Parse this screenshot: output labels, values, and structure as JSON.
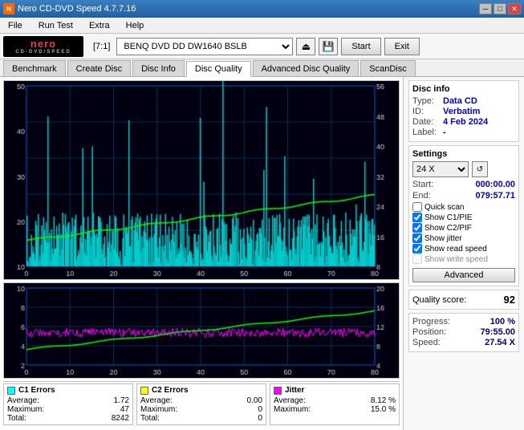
{
  "titleBar": {
    "title": "Nero CD-DVD Speed 4.7.7.16",
    "minBtn": "─",
    "maxBtn": "□",
    "closeBtn": "✕"
  },
  "menuBar": {
    "items": [
      "File",
      "Run Test",
      "Extra",
      "Help"
    ]
  },
  "toolbar": {
    "driveLabel": "[7:1]",
    "driveValue": "BENQ DVD DD DW1640 BSLB",
    "startBtn": "Start",
    "exitBtn": "Exit"
  },
  "tabs": [
    {
      "label": "Benchmark",
      "active": false
    },
    {
      "label": "Create Disc",
      "active": false
    },
    {
      "label": "Disc Info",
      "active": false
    },
    {
      "label": "Disc Quality",
      "active": true
    },
    {
      "label": "Advanced Disc Quality",
      "active": false
    },
    {
      "label": "ScanDisc",
      "active": false
    }
  ],
  "charts": {
    "topYMax": 56,
    "topYRight": [
      56,
      48,
      40,
      32,
      24,
      16,
      8
    ],
    "topYLeft": [
      50,
      40,
      30,
      20,
      10
    ],
    "topXLabels": [
      0,
      10,
      20,
      30,
      40,
      50,
      60,
      70,
      80
    ],
    "bottomYLeft": [
      10,
      8,
      6,
      4,
      2
    ],
    "bottomYRight": [
      20,
      16,
      12,
      8,
      4
    ],
    "bottomXLabels": [
      0,
      10,
      20,
      30,
      40,
      50,
      60,
      70,
      80
    ]
  },
  "stats": {
    "c1errors": {
      "label": "C1 Errors",
      "color": "#00ffff",
      "average": "1.72",
      "maximum": "47",
      "total": "8242"
    },
    "c2errors": {
      "label": "C2 Errors",
      "color": "#ffff00",
      "average": "0.00",
      "maximum": "0",
      "total": "0"
    },
    "jitter": {
      "label": "Jitter",
      "color": "#ff00ff",
      "average": "8.12 %",
      "maximum": "15.0 %",
      "total": ""
    }
  },
  "discInfo": {
    "title": "Disc info",
    "typeLabel": "Type:",
    "typeVal": "Data CD",
    "idLabel": "ID:",
    "idVal": "Verbatim",
    "dateLabel": "Date:",
    "dateVal": "4 Feb 2024",
    "labelLabel": "Label:",
    "labelVal": "-"
  },
  "settings": {
    "title": "Settings",
    "speedVal": "24 X",
    "startLabel": "Start:",
    "startVal": "000:00.00",
    "endLabel": "End:",
    "endVal": "079:57.71",
    "quickScan": "Quick scan",
    "showC1PIE": "Show C1/PIE",
    "showC2PIF": "Show C2/PIF",
    "showJitter": "Show jitter",
    "showReadSpeed": "Show read speed",
    "showWriteSpeed": "Show write speed",
    "advancedBtn": "Advanced"
  },
  "quality": {
    "label": "Quality score:",
    "value": "92"
  },
  "progress": {
    "progressLabel": "Progress:",
    "progressVal": "100 %",
    "positionLabel": "Position:",
    "positionVal": "79:55.00",
    "speedLabel": "Speed:",
    "speedVal": "27.54 X"
  }
}
